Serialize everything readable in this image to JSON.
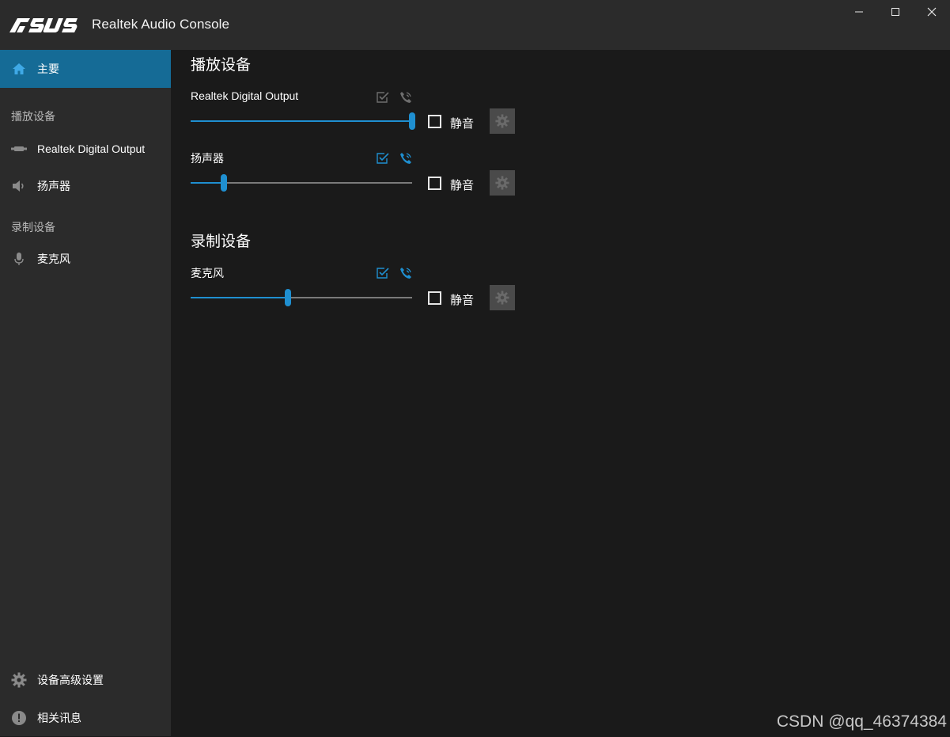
{
  "app": {
    "brand": "ASUS",
    "title": "Realtek Audio Console",
    "window_controls": {
      "minimize": "—",
      "maximize": "☐",
      "close": "✕"
    }
  },
  "sidebar": {
    "home": {
      "label": "主要",
      "icon": "home-icon"
    },
    "playback_header": "播放设备",
    "playback_items": [
      {
        "label": "Realtek Digital Output",
        "icon": "digital-output-icon"
      },
      {
        "label": "扬声器",
        "icon": "speaker-icon"
      }
    ],
    "recording_header": "录制设备",
    "recording_items": [
      {
        "label": "麦克风",
        "icon": "microphone-icon"
      }
    ],
    "advanced": {
      "label": "设备高级设置",
      "icon": "gear-icon"
    },
    "info": {
      "label": "相关讯息",
      "icon": "info-icon"
    }
  },
  "main": {
    "playback_title": "播放设备",
    "recording_title": "录制设备",
    "devices": [
      {
        "name": "Realtek Digital Output",
        "volume": 1.0,
        "mute_label": "静音",
        "muted": false,
        "default_enabled": false,
        "comm_enabled": false
      },
      {
        "name": "扬声器",
        "volume": 0.15,
        "mute_label": "静音",
        "muted": false,
        "default_enabled": true,
        "comm_enabled": true
      },
      {
        "name": "麦克风",
        "volume": 0.44,
        "mute_label": "静音",
        "muted": false,
        "default_enabled": true,
        "comm_enabled": true
      }
    ]
  },
  "watermark": "CSDN @qq_46374384",
  "colors": {
    "accent": "#1f8fd0",
    "active_nav": "#156b96",
    "sidebar_bg": "#2b2b2b",
    "main_bg": "#1a1a1a",
    "disabled_icon": "#6e6e6e"
  }
}
